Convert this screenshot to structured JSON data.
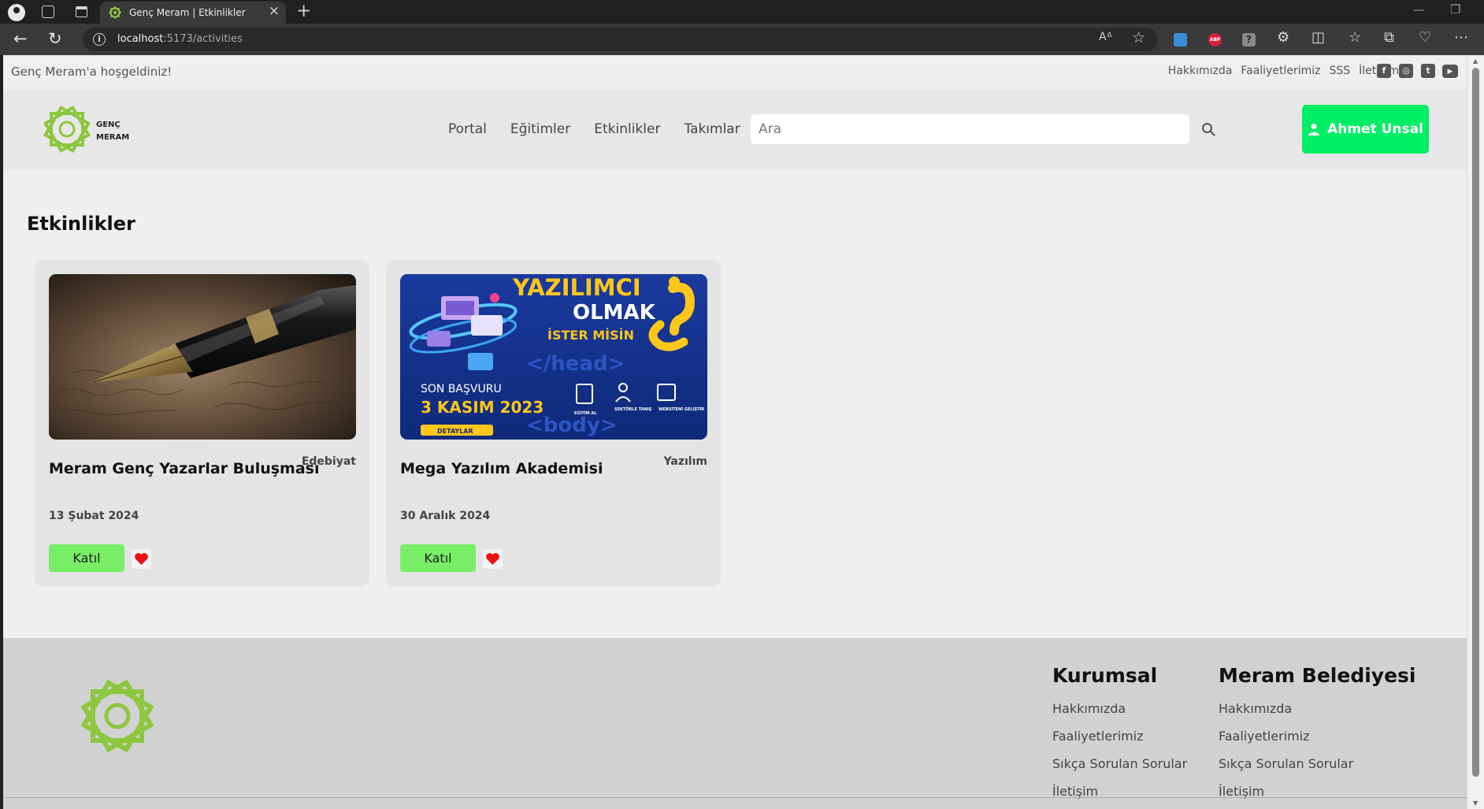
{
  "browser": {
    "tab_title": "Genç Meram | Etkinlikler",
    "url_host": "localhost",
    "url_rest": ":5173/activities",
    "extension_abp_label": "ABP",
    "extension_help_label": "?"
  },
  "site": {
    "welcome": "Genç Meram'a hoşgeldiniz!",
    "top_links": [
      "Hakkımızda",
      "Faaliyetlerimiz",
      "SSS",
      "İletişim"
    ],
    "brand_line1": "GENÇ",
    "brand_line2": "MERAM",
    "nav": [
      "Portal",
      "Eğitimler",
      "Etkinlikler",
      "Takımlar"
    ],
    "search_placeholder": "Ara",
    "user_name": "Ahmet Unsal",
    "accent_green": "#00ee66",
    "logo_green": "#8dc63f"
  },
  "page": {
    "title": "Etkinlikler",
    "cards": [
      {
        "title": "Meram Genç Yazarlar Buluşması",
        "category": "Edebiyat",
        "date": "13 Şubat 2024",
        "button": "Katıl"
      },
      {
        "title": "Mega Yazılım Akademisi",
        "category": "Yazılım",
        "date": "30 Aralık 2024",
        "button": "Katıl",
        "poster": {
          "line1": "YAZILIMCI",
          "line2": "OLMAK",
          "line3": "İSTER MİSİN",
          "deadline_label": "SON BAŞVURU",
          "deadline_date": "3 KASIM 2023",
          "details": "DETAYLAR",
          "icon1": "EĞİTİM AL",
          "icon2": "SEKTÖRLE TANIŞ",
          "icon3": "WEBSİTENİ GELİŞTİR",
          "code_head": "</head>",
          "code_body": "<body>"
        }
      }
    ]
  },
  "footer": {
    "col1": {
      "heading": "Kurumsal",
      "links": [
        "Hakkımızda",
        "Faaliyetlerimiz",
        "Sıkça Sorulan Sorular",
        "İletişim"
      ]
    },
    "col2": {
      "heading": "Meram Belediyesi",
      "links": [
        "Hakkımızda",
        "Faaliyetlerimiz",
        "Sıkça Sorulan Sorular",
        "İletişim"
      ]
    }
  }
}
